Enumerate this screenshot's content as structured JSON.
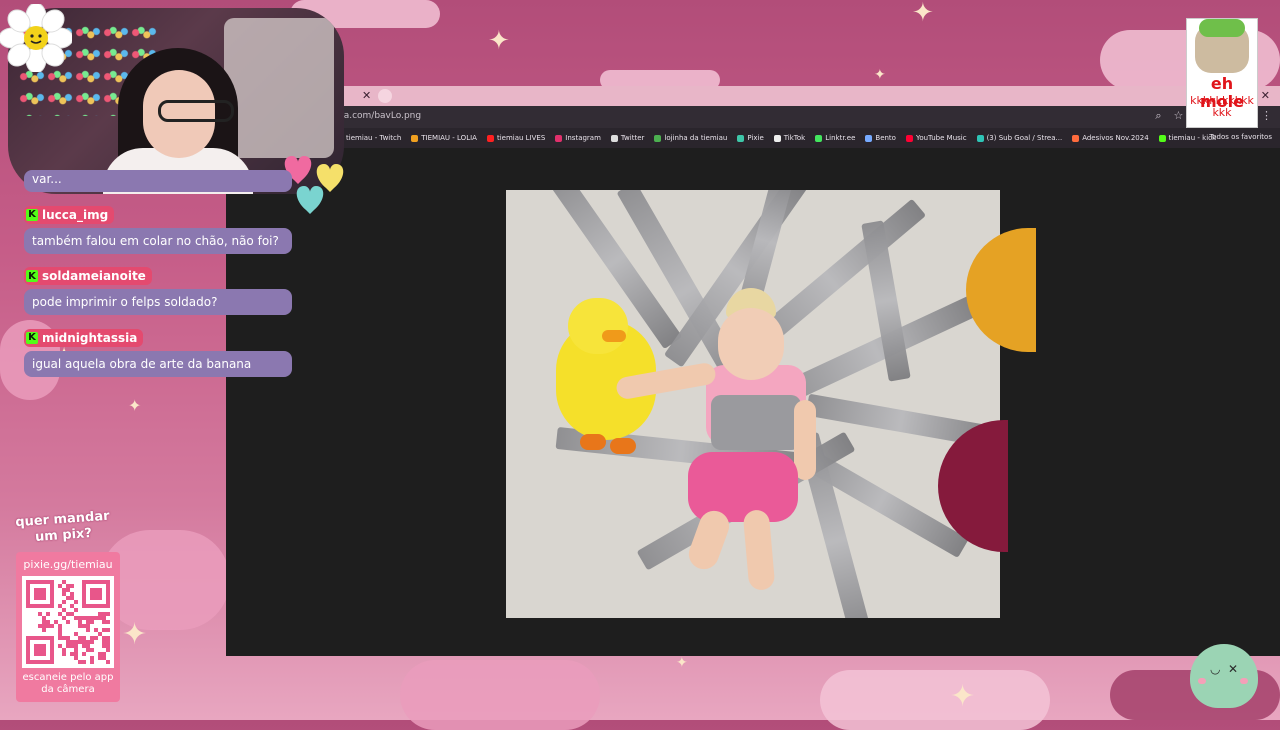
{
  "browser": {
    "url": "na.com/bavLo.png",
    "bookmarks": [
      {
        "label": "tiemiau - Twitch",
        "color": "#9146ff"
      },
      {
        "label": "TIEMIAU - LOLIA",
        "color": "#f0a020"
      },
      {
        "label": "tiemiau LIVES",
        "color": "#ff2020"
      },
      {
        "label": "Instagram",
        "color": "#e1306c"
      },
      {
        "label": "Twitter",
        "color": "#dddddd"
      },
      {
        "label": "lojinha da tiemiau",
        "color": "#4caf50"
      },
      {
        "label": "Pixie",
        "color": "#3ec6a8"
      },
      {
        "label": "TikTok",
        "color": "#eeeeee"
      },
      {
        "label": "Linktr.ee",
        "color": "#43e55e"
      },
      {
        "label": "Bento",
        "color": "#77aaff"
      },
      {
        "label": "YouTube Music",
        "color": "#ff0033"
      },
      {
        "label": "(3) Sub Goal / Strea...",
        "color": "#2ec4b6"
      },
      {
        "label": "Adesivos Nov.2024",
        "color": "#ff6b3d"
      },
      {
        "label": "tiemiau - kick",
        "color": "#53fc18"
      }
    ],
    "favorites": "Todos os favoritos"
  },
  "chat": {
    "first_partial": "var...",
    "messages": [
      {
        "user": "lucca_img",
        "text": "também falou em colar no chão, não foi?"
      },
      {
        "user": "soldameianoite",
        "text": "pode imprimir o felps soldado?"
      },
      {
        "user": "midnightassia",
        "text": "igual aquela obra de arte da banana"
      }
    ]
  },
  "meme": {
    "title": "eh mole",
    "sub": "kkkkkkkkkkkkk"
  },
  "pix": {
    "title": "quer mandar um pix?",
    "url": "pixie.gg/tiemiau",
    "caption": "escaneie pelo app da câmera"
  }
}
